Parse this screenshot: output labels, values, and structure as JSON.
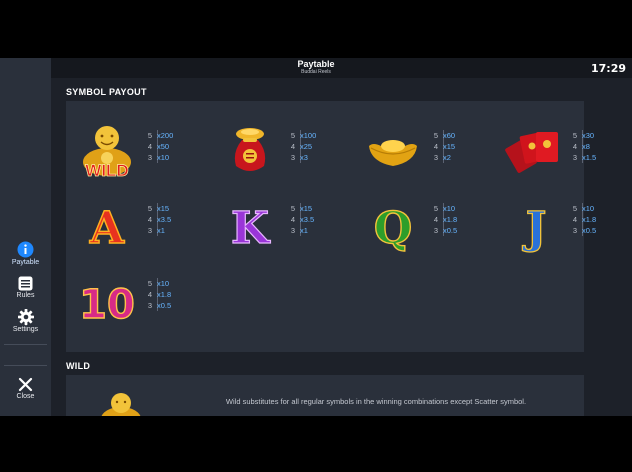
{
  "header": {
    "title": "Paytable",
    "subtitle": "Buddai Reels",
    "clock": "17:29"
  },
  "sidebar": {
    "items": [
      {
        "label": "Paytable",
        "icon": "info-icon",
        "active": true
      },
      {
        "label": "Rules",
        "icon": "document-icon",
        "active": false
      },
      {
        "label": "Settings",
        "icon": "gear-icon",
        "active": false
      }
    ],
    "close_label": "Close"
  },
  "symbol_payout": {
    "heading": "SYMBOL PAYOUT",
    "symbols": [
      {
        "name": "wild-buddha",
        "image_text": "WILD",
        "payouts": [
          {
            "count": "5",
            "value": "x200"
          },
          {
            "count": "4",
            "value": "x50"
          },
          {
            "count": "3",
            "value": "x10"
          }
        ]
      },
      {
        "name": "money-bag",
        "payouts": [
          {
            "count": "5",
            "value": "x100"
          },
          {
            "count": "4",
            "value": "x25"
          },
          {
            "count": "3",
            "value": "x3"
          }
        ]
      },
      {
        "name": "gold-ingot",
        "payouts": [
          {
            "count": "5",
            "value": "x60"
          },
          {
            "count": "4",
            "value": "x15"
          },
          {
            "count": "3",
            "value": "x2"
          }
        ]
      },
      {
        "name": "red-envelopes",
        "payouts": [
          {
            "count": "5",
            "value": "x30"
          },
          {
            "count": "4",
            "value": "x8"
          },
          {
            "count": "3",
            "value": "x1.5"
          }
        ]
      },
      {
        "name": "letter-a",
        "image_text": "A",
        "payouts": [
          {
            "count": "5",
            "value": "x15"
          },
          {
            "count": "4",
            "value": "x3.5"
          },
          {
            "count": "3",
            "value": "x1"
          }
        ]
      },
      {
        "name": "letter-k",
        "image_text": "K",
        "payouts": [
          {
            "count": "5",
            "value": "x15"
          },
          {
            "count": "4",
            "value": "x3.5"
          },
          {
            "count": "3",
            "value": "x1"
          }
        ]
      },
      {
        "name": "letter-q",
        "image_text": "Q",
        "payouts": [
          {
            "count": "5",
            "value": "x10"
          },
          {
            "count": "4",
            "value": "x1.8"
          },
          {
            "count": "3",
            "value": "x0.5"
          }
        ]
      },
      {
        "name": "letter-j",
        "image_text": "J",
        "payouts": [
          {
            "count": "5",
            "value": "x10"
          },
          {
            "count": "4",
            "value": "x1.8"
          },
          {
            "count": "3",
            "value": "x0.5"
          }
        ]
      },
      {
        "name": "number-10",
        "image_text": "10",
        "payouts": [
          {
            "count": "5",
            "value": "x10"
          },
          {
            "count": "4",
            "value": "x1.8"
          },
          {
            "count": "3",
            "value": "x0.5"
          }
        ]
      }
    ]
  },
  "wild": {
    "heading": "WILD",
    "description": "Wild substitutes for all regular symbols in the winning combinations except Scatter symbol."
  },
  "colors": {
    "background": "#1d2129",
    "panel": "#2a303b",
    "payout_value": "#67b5ff",
    "active_nav": "#1e88ff"
  }
}
